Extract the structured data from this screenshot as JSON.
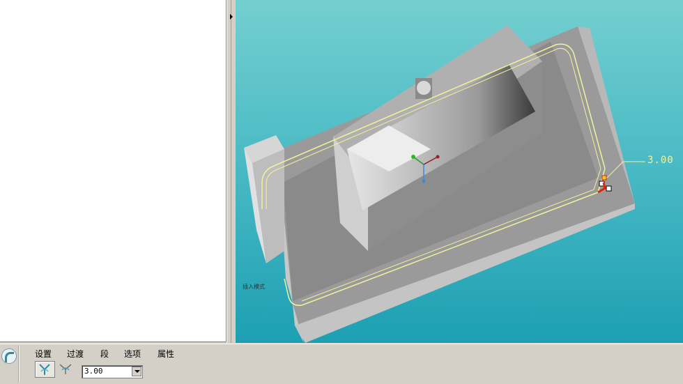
{
  "dashboard": {
    "tabs": [
      "设置",
      "过渡",
      "段",
      "选项",
      "属性"
    ],
    "radius_value": "3.00"
  },
  "viewport": {
    "dimension_label": "3.00",
    "mode_label": "插入模式"
  },
  "colors": {
    "background_top": "#74cfd0",
    "background_bottom": "#1d9fb3",
    "edge_highlight": "#f2f29a",
    "handle_red": "#e02010"
  },
  "icons": {
    "dashboard": "round-feature-icon",
    "type_1": "round-set-icon",
    "type_2": "round-transition-icon"
  }
}
